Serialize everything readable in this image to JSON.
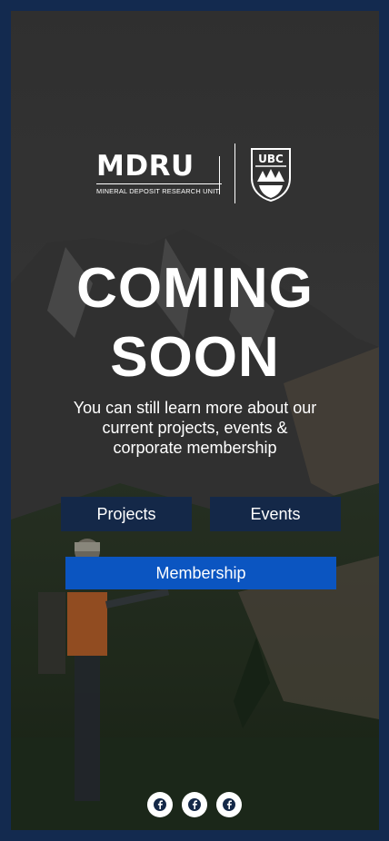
{
  "brand": {
    "name": "MDRU",
    "tagline": "MINERAL DEPOSIT RESEARCH UNIT",
    "partner_logo_text": "UBC"
  },
  "hero": {
    "heading_line1": "COMING",
    "heading_line2": "SOON",
    "subtext_line1": "You can still learn more about our",
    "subtext_line2": "current projects, events &",
    "subtext_line3": "corporate membership"
  },
  "buttons": {
    "projects": "Projects",
    "events": "Events",
    "membership": "Membership"
  },
  "social": {
    "icons": [
      "facebook-icon",
      "facebook-icon",
      "facebook-icon"
    ]
  },
  "colors": {
    "border": "#132a4f",
    "button_dark": "#142848",
    "button_accent": "#0b55c1"
  }
}
